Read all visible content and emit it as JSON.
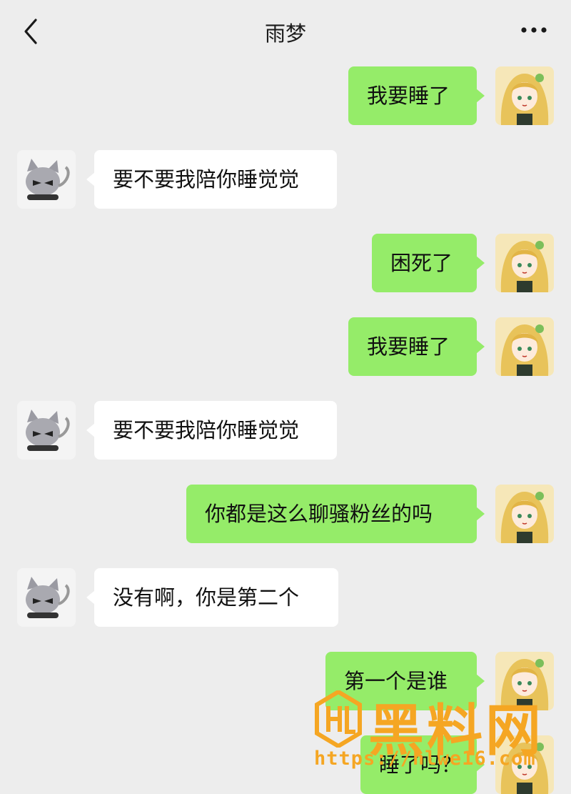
{
  "header": {
    "title": "雨梦",
    "back_icon": "chevron-left-icon",
    "more_icon": "ellipsis-icon"
  },
  "messages": [
    {
      "sender": "me",
      "text": "我要睡了"
    },
    {
      "sender": "other",
      "text": "要不要我陪你睡觉觉"
    },
    {
      "sender": "me",
      "text": "困死了"
    },
    {
      "sender": "me",
      "text": "我要睡了"
    },
    {
      "sender": "other",
      "text": "要不要我陪你睡觉觉"
    },
    {
      "sender": "me",
      "text": "你都是这么聊骚粉丝的吗"
    },
    {
      "sender": "other",
      "text": "没有啊，你是第二个"
    },
    {
      "sender": "me",
      "text": "第一个是谁"
    },
    {
      "sender": "me",
      "text": "睡了吗？"
    }
  ],
  "watermark": {
    "brand": "黑料网",
    "url": "https://hlwe16.com"
  },
  "colors": {
    "background": "#ededed",
    "sent_bubble": "#95ec69",
    "received_bubble": "#ffffff",
    "watermark": "#f5a623"
  }
}
